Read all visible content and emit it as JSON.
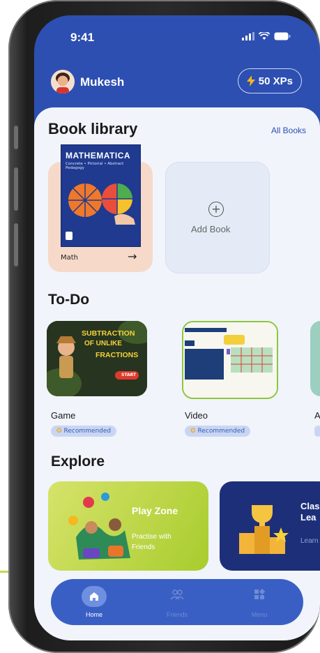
{
  "status_bar": {
    "time": "9:41"
  },
  "header": {
    "username": "Mukesh",
    "xp_label": "50 XPs"
  },
  "book_library": {
    "title": "Book library",
    "all_books_link": "All Books",
    "book": {
      "cover_title": "MATHEMATICA",
      "cover_subtitle": "Concrete • Pictorial • Abstract Pedagogy",
      "label": "Math"
    },
    "add_book_label": "Add Book"
  },
  "todo": {
    "title": "To-Do",
    "items": [
      {
        "type": "Game",
        "badge": "Recommended",
        "thumb_line1": "SUBTRACTION",
        "thumb_line2": "OF UNLIKE",
        "thumb_line3": "FRACTIONS",
        "thumb_button": "START"
      },
      {
        "type": "Video",
        "badge": "Recommended"
      },
      {
        "type": "A"
      }
    ]
  },
  "explore": {
    "title": "Explore",
    "cards": [
      {
        "title": "Play Zone",
        "subtitle": "Practise with Friends"
      },
      {
        "title_line1": "Clas",
        "title_line2": "Lea",
        "subtitle": "Learn"
      }
    ]
  },
  "tabbar": {
    "tabs": [
      {
        "label": "Home",
        "icon": "home-icon",
        "active": true
      },
      {
        "label": "Friends",
        "icon": "friends-icon",
        "active": false
      },
      {
        "label": "Menu",
        "icon": "menu-icon",
        "active": false
      }
    ]
  },
  "colors": {
    "primary": "#2d4fb1",
    "tabbar": "#3a5fc4",
    "book_card": "#f6d9c8",
    "play_zone": "#b6d23a",
    "explore_dark": "#1e2f7a"
  }
}
